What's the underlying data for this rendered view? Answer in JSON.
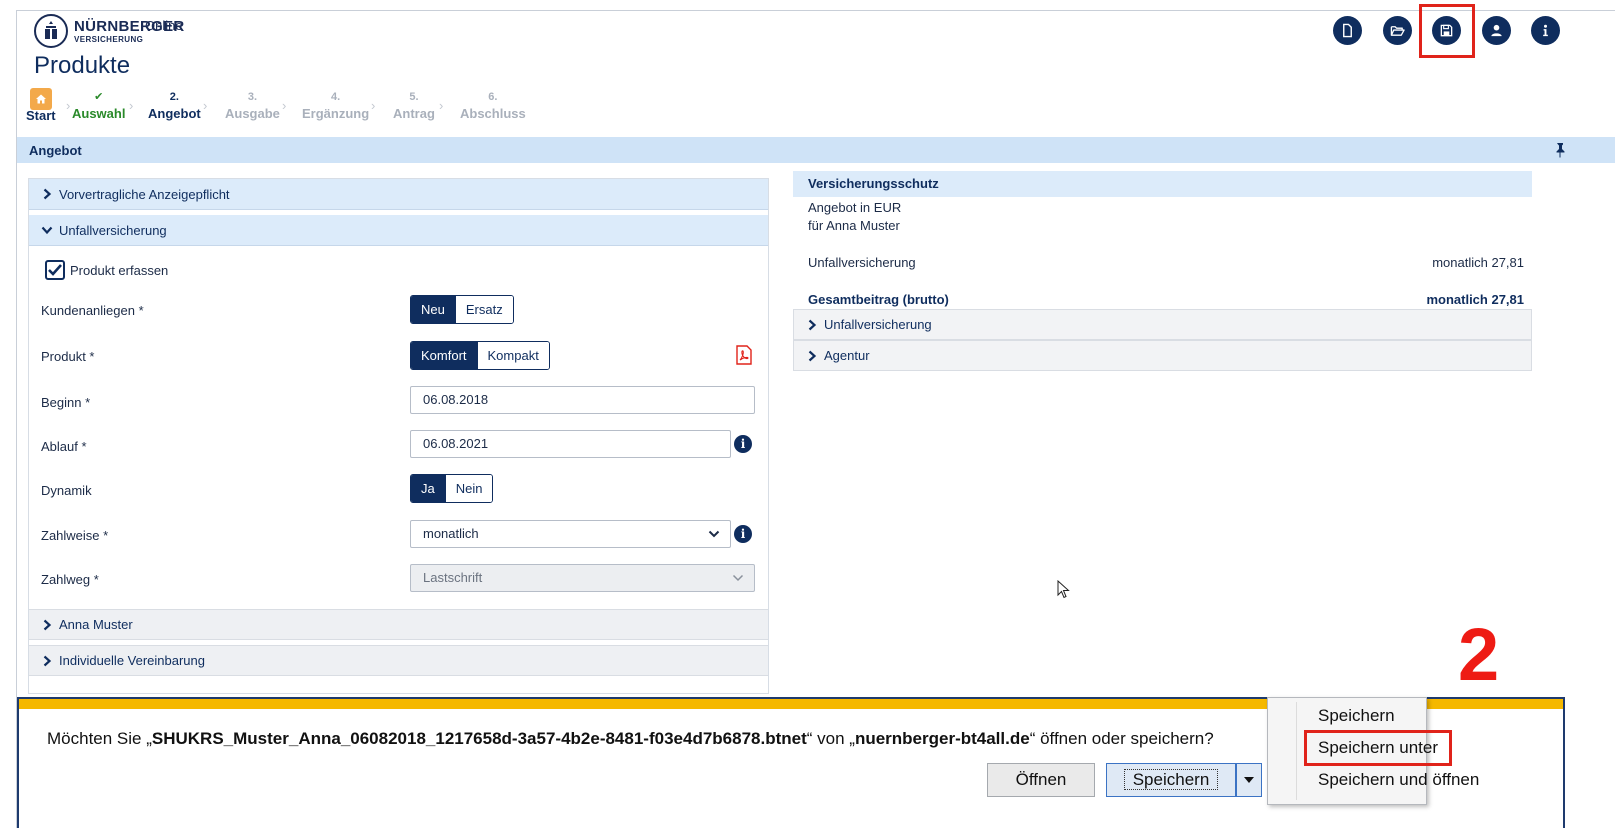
{
  "brand": {
    "name": "NÜRNBERGER",
    "sub": "VERSICHERUNG",
    "online": "Online"
  },
  "header_icons": [
    "new-document-icon",
    "open-folder-icon",
    "save-icon",
    "user-icon",
    "info-icon"
  ],
  "page_title": "Produkte",
  "steps": [
    {
      "num": "",
      "label": "Start",
      "state": "home"
    },
    {
      "num": "✔",
      "label": "Auswahl",
      "state": "done"
    },
    {
      "num": "2.",
      "label": "Angebot",
      "state": "active"
    },
    {
      "num": "3.",
      "label": "Ausgabe",
      "state": "future"
    },
    {
      "num": "4.",
      "label": "Ergänzung",
      "state": "future"
    },
    {
      "num": "5.",
      "label": "Antrag",
      "state": "future"
    },
    {
      "num": "6.",
      "label": "Abschluss",
      "state": "future"
    }
  ],
  "section_title": "Angebot",
  "left": {
    "acc_vorvertraglich": "Vorvertragliche Anzeigepflicht",
    "acc_unfall": "Unfallversicherung",
    "produkt_erfassen": "Produkt erfassen",
    "kundenanliegen": {
      "label": "Kundenanliegen *",
      "options": [
        "Neu",
        "Ersatz"
      ],
      "selected": "Neu"
    },
    "produkt": {
      "label": "Produkt *",
      "options": [
        "Komfort",
        "Kompakt"
      ],
      "selected": "Komfort"
    },
    "beginn": {
      "label": "Beginn *",
      "value": "06.08.2018"
    },
    "ablauf": {
      "label": "Ablauf *",
      "value": "06.08.2021"
    },
    "dynamik": {
      "label": "Dynamik",
      "options": [
        "Ja",
        "Nein"
      ],
      "selected": "Ja"
    },
    "zahlweise": {
      "label": "Zahlweise *",
      "value": "monatlich"
    },
    "zahlweg": {
      "label": "Zahlweg *",
      "value": "Lastschrift"
    },
    "acc_anna": "Anna Muster",
    "acc_individuell": "Individuelle Vereinbarung"
  },
  "right": {
    "title": "Versicherungsschutz",
    "line1": "Angebot in EUR",
    "line2": "für Anna Muster",
    "unfall_label": "Unfallversicherung",
    "unfall_value": "monatlich 27,81",
    "gesamt_label": "Gesamtbeitrag (brutto)",
    "gesamt_value": "monatlich 27,81",
    "acc_unfall": "Unfallversicherung",
    "acc_agentur": "Agentur"
  },
  "download": {
    "prefix": "Möchten Sie „",
    "filename": "SHUKRS_Muster_Anna_06082018_1217658d-3a57-4b2e-8481-f03e4d7b6878.btnet",
    "mid": "“ von „",
    "site": "nuernberger-bt4all.de",
    "suffix": "“ öffnen oder speichern?",
    "open_label": "Öffnen",
    "save_label": "Speichern"
  },
  "menu": {
    "items": [
      "Speichern",
      "Speichern unter",
      "Speichern und öffnen"
    ],
    "highlighted": "Speichern unter"
  },
  "annotation_number": "2",
  "colors": {
    "navy": "#0f2d5e",
    "accent_light": "#dcebfa",
    "highlight_red": "#e0231a",
    "done_green": "#2a8a2a",
    "home_orange": "#f3a94a",
    "stripe_yellow": "#f5b800"
  }
}
